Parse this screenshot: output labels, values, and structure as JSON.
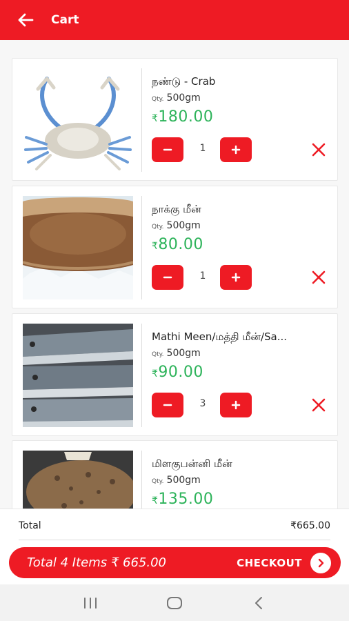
{
  "app": {
    "title": "Cart"
  },
  "colors": {
    "brand": "#ee1b24",
    "price": "#2db35a",
    "remove": "#ee1b24"
  },
  "items": [
    {
      "name": "நண்டு - Crab",
      "qty_label": "Qty.",
      "qty_value": "500gm",
      "currency": "₹",
      "price": "180.00",
      "count": "1",
      "image": "crab"
    },
    {
      "name": "நாக்கு மீன்",
      "qty_label": "Qty.",
      "qty_value": "500gm",
      "currency": "₹",
      "price": "80.00",
      "count": "1",
      "image": "sole-fish"
    },
    {
      "name": "Mathi Meen/மத்தி மீன்/Sa...",
      "qty_label": "Qty.",
      "qty_value": "500gm",
      "currency": "₹",
      "price": "90.00",
      "count": "3",
      "image": "sardines"
    },
    {
      "name": "மிளகுபன்னி மீன்",
      "qty_label": "Qty.",
      "qty_value": "500gm",
      "currency": "₹",
      "price": "135.00",
      "count": "",
      "image": "grouper"
    }
  ],
  "summary": {
    "total_label": "Total",
    "total_value": "₹665.00"
  },
  "checkout": {
    "summary_text": "Total 4 Items ₹ 665.00",
    "button_label": "CHECKOUT"
  },
  "icons": {
    "back": "arrow-left-icon",
    "minus": "minus-icon",
    "plus": "plus-icon",
    "remove": "close-icon",
    "checkout": "chevron-right-icon"
  }
}
